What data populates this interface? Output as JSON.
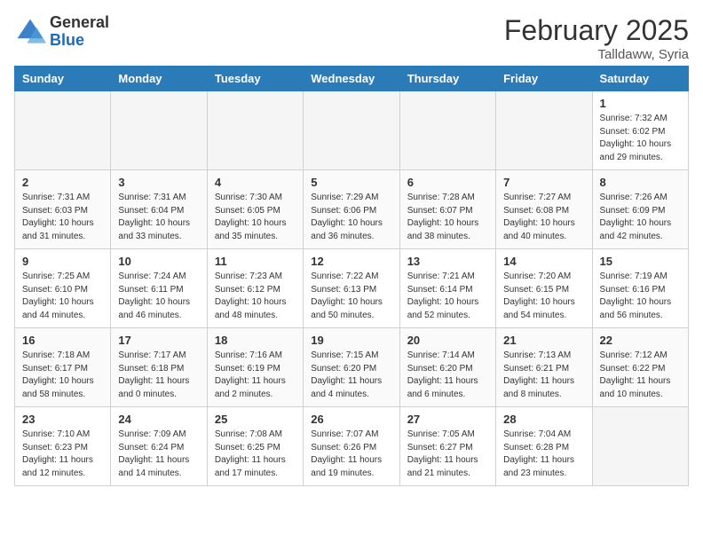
{
  "header": {
    "logo_general": "General",
    "logo_blue": "Blue",
    "month_title": "February 2025",
    "location": "Talldaww, Syria"
  },
  "days_of_week": [
    "Sunday",
    "Monday",
    "Tuesday",
    "Wednesday",
    "Thursday",
    "Friday",
    "Saturday"
  ],
  "weeks": [
    [
      {
        "day": "",
        "empty": true
      },
      {
        "day": "",
        "empty": true
      },
      {
        "day": "",
        "empty": true
      },
      {
        "day": "",
        "empty": true
      },
      {
        "day": "",
        "empty": true
      },
      {
        "day": "",
        "empty": true
      },
      {
        "day": "1",
        "sunrise": "7:32 AM",
        "sunset": "6:02 PM",
        "daylight": "10 hours and 29 minutes."
      }
    ],
    [
      {
        "day": "2",
        "sunrise": "7:31 AM",
        "sunset": "6:03 PM",
        "daylight": "10 hours and 31 minutes."
      },
      {
        "day": "3",
        "sunrise": "7:31 AM",
        "sunset": "6:04 PM",
        "daylight": "10 hours and 33 minutes."
      },
      {
        "day": "4",
        "sunrise": "7:30 AM",
        "sunset": "6:05 PM",
        "daylight": "10 hours and 35 minutes."
      },
      {
        "day": "5",
        "sunrise": "7:29 AM",
        "sunset": "6:06 PM",
        "daylight": "10 hours and 36 minutes."
      },
      {
        "day": "6",
        "sunrise": "7:28 AM",
        "sunset": "6:07 PM",
        "daylight": "10 hours and 38 minutes."
      },
      {
        "day": "7",
        "sunrise": "7:27 AM",
        "sunset": "6:08 PM",
        "daylight": "10 hours and 40 minutes."
      },
      {
        "day": "8",
        "sunrise": "7:26 AM",
        "sunset": "6:09 PM",
        "daylight": "10 hours and 42 minutes."
      }
    ],
    [
      {
        "day": "9",
        "sunrise": "7:25 AM",
        "sunset": "6:10 PM",
        "daylight": "10 hours and 44 minutes."
      },
      {
        "day": "10",
        "sunrise": "7:24 AM",
        "sunset": "6:11 PM",
        "daylight": "10 hours and 46 minutes."
      },
      {
        "day": "11",
        "sunrise": "7:23 AM",
        "sunset": "6:12 PM",
        "daylight": "10 hours and 48 minutes."
      },
      {
        "day": "12",
        "sunrise": "7:22 AM",
        "sunset": "6:13 PM",
        "daylight": "10 hours and 50 minutes."
      },
      {
        "day": "13",
        "sunrise": "7:21 AM",
        "sunset": "6:14 PM",
        "daylight": "10 hours and 52 minutes."
      },
      {
        "day": "14",
        "sunrise": "7:20 AM",
        "sunset": "6:15 PM",
        "daylight": "10 hours and 54 minutes."
      },
      {
        "day": "15",
        "sunrise": "7:19 AM",
        "sunset": "6:16 PM",
        "daylight": "10 hours and 56 minutes."
      }
    ],
    [
      {
        "day": "16",
        "sunrise": "7:18 AM",
        "sunset": "6:17 PM",
        "daylight": "10 hours and 58 minutes."
      },
      {
        "day": "17",
        "sunrise": "7:17 AM",
        "sunset": "6:18 PM",
        "daylight": "11 hours and 0 minutes."
      },
      {
        "day": "18",
        "sunrise": "7:16 AM",
        "sunset": "6:19 PM",
        "daylight": "11 hours and 2 minutes."
      },
      {
        "day": "19",
        "sunrise": "7:15 AM",
        "sunset": "6:20 PM",
        "daylight": "11 hours and 4 minutes."
      },
      {
        "day": "20",
        "sunrise": "7:14 AM",
        "sunset": "6:20 PM",
        "daylight": "11 hours and 6 minutes."
      },
      {
        "day": "21",
        "sunrise": "7:13 AM",
        "sunset": "6:21 PM",
        "daylight": "11 hours and 8 minutes."
      },
      {
        "day": "22",
        "sunrise": "7:12 AM",
        "sunset": "6:22 PM",
        "daylight": "11 hours and 10 minutes."
      }
    ],
    [
      {
        "day": "23",
        "sunrise": "7:10 AM",
        "sunset": "6:23 PM",
        "daylight": "11 hours and 12 minutes."
      },
      {
        "day": "24",
        "sunrise": "7:09 AM",
        "sunset": "6:24 PM",
        "daylight": "11 hours and 14 minutes."
      },
      {
        "day": "25",
        "sunrise": "7:08 AM",
        "sunset": "6:25 PM",
        "daylight": "11 hours and 17 minutes."
      },
      {
        "day": "26",
        "sunrise": "7:07 AM",
        "sunset": "6:26 PM",
        "daylight": "11 hours and 19 minutes."
      },
      {
        "day": "27",
        "sunrise": "7:05 AM",
        "sunset": "6:27 PM",
        "daylight": "11 hours and 21 minutes."
      },
      {
        "day": "28",
        "sunrise": "7:04 AM",
        "sunset": "6:28 PM",
        "daylight": "11 hours and 23 minutes."
      },
      {
        "day": "",
        "empty": true
      }
    ]
  ]
}
